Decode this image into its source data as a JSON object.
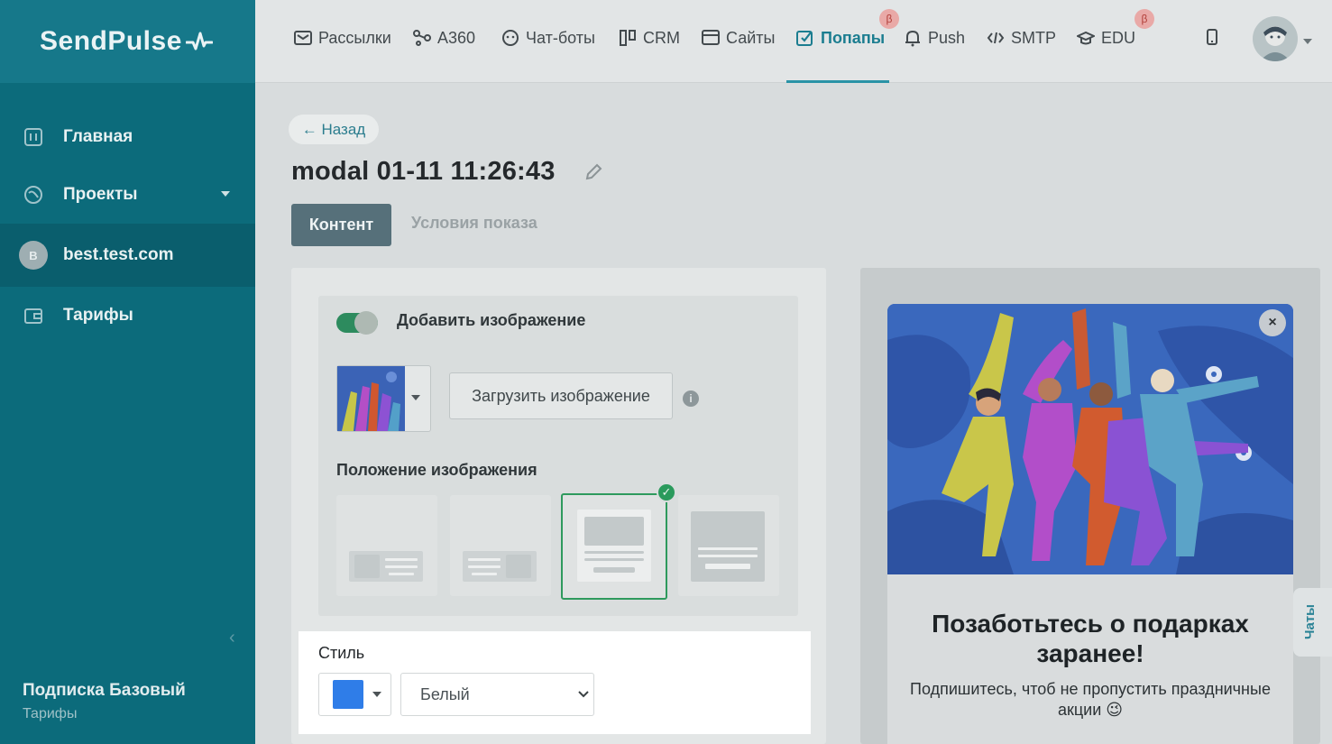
{
  "app": {
    "logo_text": "SendPulse"
  },
  "sidebar": {
    "items": [
      {
        "label": "Главная",
        "icon": "dashboard-icon"
      },
      {
        "label": "Проекты",
        "icon": "globe-icon"
      },
      {
        "label": "best.test.com",
        "avatar_letter": "B"
      },
      {
        "label": "Тарифы",
        "icon": "wallet-icon"
      }
    ],
    "plan_name": "Подписка Базовый",
    "plan_link": "Тарифы"
  },
  "topnav": {
    "items": [
      {
        "label": "Рассылки",
        "icon": "mail-icon"
      },
      {
        "label": "A360",
        "icon": "automation-icon"
      },
      {
        "label": "Чат-боты",
        "icon": "chatbot-icon"
      },
      {
        "label": "CRM",
        "icon": "crm-icon"
      },
      {
        "label": "Сайты",
        "icon": "website-icon"
      },
      {
        "label": "Попапы",
        "icon": "popup-icon",
        "active": true
      },
      {
        "label": "Push",
        "icon": "bell-icon"
      },
      {
        "label": "SMTP",
        "icon": "code-icon"
      },
      {
        "label": "EDU",
        "icon": "graduation-cap-icon"
      }
    ],
    "beta_badge": "β"
  },
  "page": {
    "back_label": "← Назад",
    "title": "modal 01-11 11:26:43",
    "tabs": [
      "Контент",
      "Условия показа"
    ]
  },
  "editor": {
    "add_image_label": "Добавить изображение",
    "add_image_enabled": true,
    "upload_label": "Загрузить изображение",
    "info_glyph": "i",
    "position_label": "Положение изображения",
    "position_selected_index": 2,
    "style_label": "Стиль",
    "style_color": "#2f7de8",
    "style_value": "Белый"
  },
  "preview": {
    "close_glyph": "×",
    "title": "Позаботьтесь о подарках заранее!",
    "subtitle": "Подпишитесь, чтоб не пропустить праздничные акции 😉"
  },
  "chat_widget": {
    "label": "Чаты"
  },
  "colors": {
    "accent": "#0c6b7b",
    "active_nav": "#1b7d90",
    "success": "#2e9a5d"
  }
}
